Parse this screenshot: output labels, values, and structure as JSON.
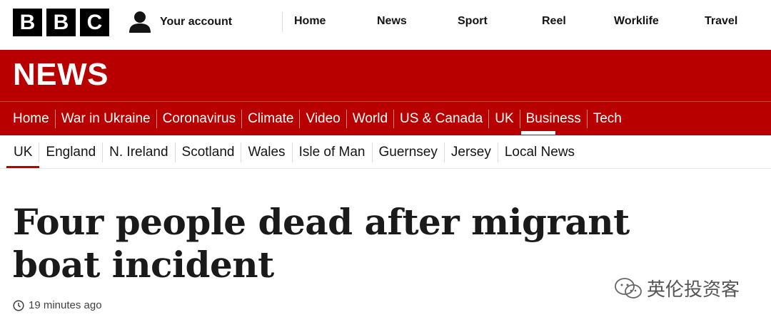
{
  "logo": {
    "letters": [
      "B",
      "B",
      "C"
    ]
  },
  "account": {
    "label": "Your account"
  },
  "top_nav": [
    "Home",
    "News",
    "Sport",
    "Reel",
    "Worklife",
    "Travel"
  ],
  "section_title": "NEWS",
  "main_nav": {
    "items": [
      "Home",
      "War in Ukraine",
      "Coronavirus",
      "Climate",
      "Video",
      "World",
      "US & Canada",
      "UK",
      "Business",
      "Tech"
    ],
    "active": "UK"
  },
  "sub_nav": {
    "items": [
      "UK",
      "England",
      "N. Ireland",
      "Scotland",
      "Wales",
      "Isle of Man",
      "Guernsey",
      "Jersey",
      "Local News"
    ],
    "active": "UK"
  },
  "article": {
    "headline": "Four people dead after migrant boat incident",
    "timestamp": "19 minutes ago"
  },
  "watermark": {
    "text": "英伦投资客"
  },
  "colors": {
    "brand_red": "#b80000",
    "text": "#141414"
  }
}
